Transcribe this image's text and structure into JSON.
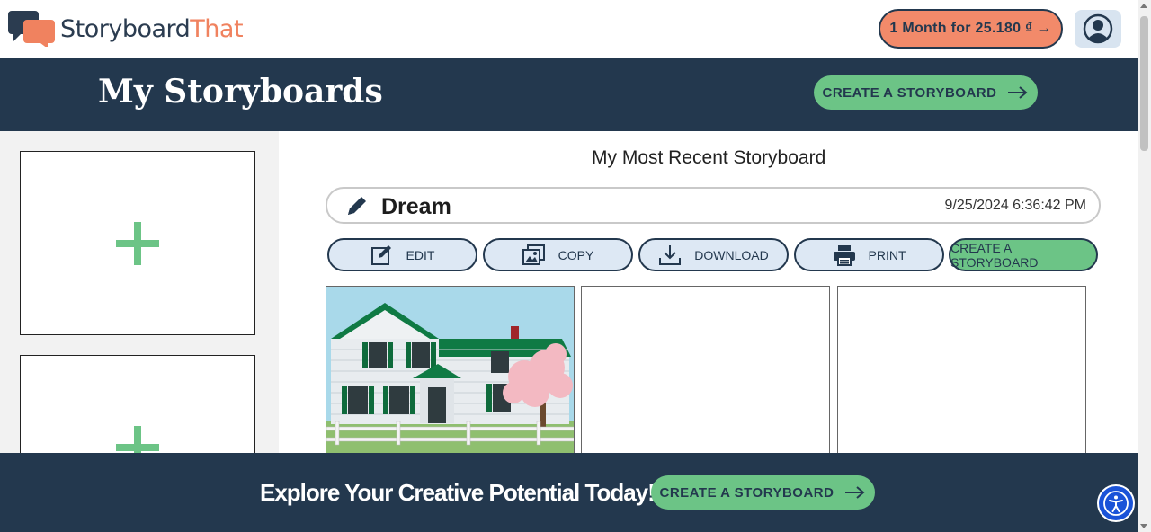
{
  "brand": {
    "name_part1": "Storyboard",
    "name_part2": "That"
  },
  "promo": {
    "label": "1 Month for 25.180 ₫ →"
  },
  "header": {
    "title": "My Storyboards",
    "create_label": "CREATE A STORYBOARD"
  },
  "recent": {
    "title": "My Most Recent Storyboard",
    "storyboard_name": "Dream",
    "date": "9/25/2024 6:36:42 PM",
    "actions": {
      "edit": "EDIT",
      "copy": "COPY",
      "download": "DOWNLOAD",
      "print": "PRINT",
      "create": "CREATE A STORYBOARD"
    }
  },
  "banner": {
    "text": "Explore Your Creative Potential Today!",
    "create_label": "CREATE A STORYBOARD"
  },
  "colors": {
    "navy": "#23384e",
    "green": "#6cc486",
    "coral": "#f0825f",
    "light_blue": "#dde8f4"
  },
  "icons": [
    "logo-icon",
    "user-icon",
    "arrow-right-icon",
    "plus-icon",
    "pencil-icon",
    "edit-icon",
    "copy-icon",
    "download-icon",
    "print-icon",
    "accessibility-icon"
  ]
}
